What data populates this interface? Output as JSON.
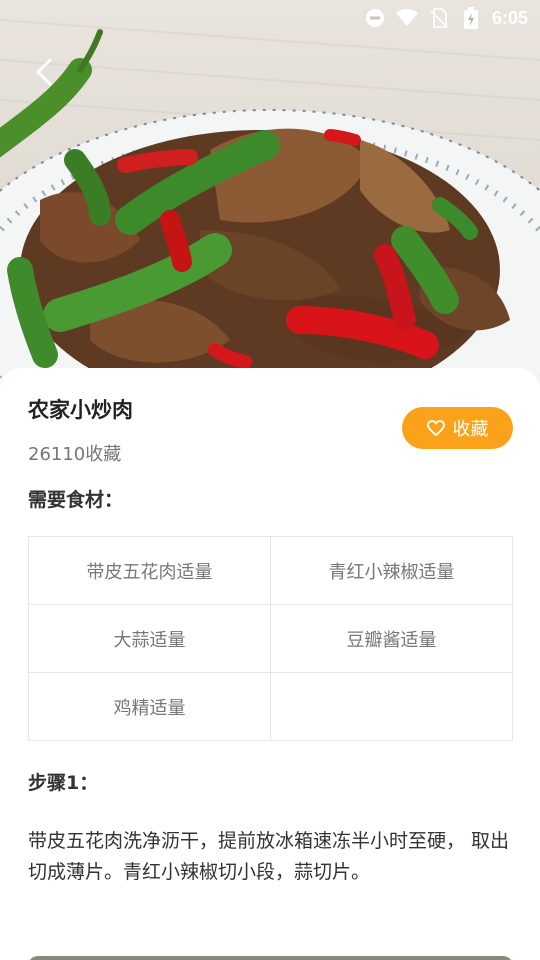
{
  "status_bar": {
    "time": "6:05",
    "icons": [
      "do-not-disturb-icon",
      "wifi-icon",
      "no-sim-icon",
      "battery-charging-icon"
    ]
  },
  "header": {
    "back_icon": "chevron-left-icon"
  },
  "recipe": {
    "title": "农家小炒肉",
    "favorites_count": "26110收藏",
    "favorite_button": {
      "label": "收藏",
      "icon": "heart-outline-icon",
      "color": "#f9a21a"
    }
  },
  "ingredients": {
    "heading": "需要食材：",
    "items": [
      "带皮五花肉适量",
      "青红小辣椒适量",
      "大蒜适量",
      "豆瓣酱适量",
      "鸡精适量",
      ""
    ]
  },
  "steps": [
    {
      "heading": "步骤1：",
      "text": "带皮五花肉洗净沥干，提前放冰箱速冻半小时至硬， 取出切成薄片。青红小辣椒切小段，蒜切片。"
    }
  ]
}
